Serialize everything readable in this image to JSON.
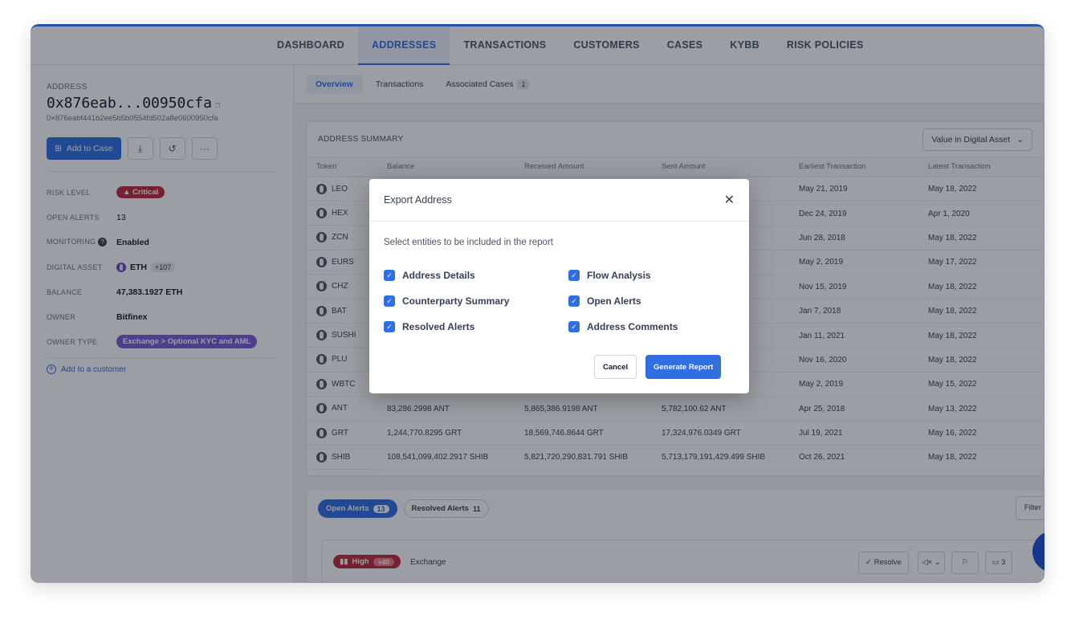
{
  "nav": {
    "tabs": [
      "DASHBOARD",
      "ADDRESSES",
      "TRANSACTIONS",
      "CUSTOMERS",
      "CASES",
      "KYBB",
      "RISK POLICIES"
    ],
    "active": "ADDRESSES"
  },
  "address": {
    "label": "ADDRESS",
    "short": "0x876eab...00950cfa",
    "full": "0×876eabf441b2ee5b5b0554fd502a8e0600950cfa",
    "add_to_case": "Add to Case"
  },
  "details": {
    "risk_level": {
      "k": "RISK LEVEL",
      "v": "Critical"
    },
    "open_alerts": {
      "k": "OPEN ALERTS",
      "v": "13"
    },
    "monitoring": {
      "k": "MONITORING",
      "v": "Enabled"
    },
    "digital_asset": {
      "k": "DIGITAL ASSET",
      "v": "ETH",
      "extra": "+107"
    },
    "balance": {
      "k": "BALANCE",
      "v": "47,383.1927 ETH"
    },
    "owner": {
      "k": "OWNER",
      "v": "Bitfinex"
    },
    "owner_type": {
      "k": "OWNER TYPE",
      "v": "Exchange > Optional KYC and AML"
    },
    "add_customer": "Add to a customer"
  },
  "subtabs": {
    "overview": "Overview",
    "transactions": "Transactions",
    "cases": "Associated Cases",
    "cases_count": "1"
  },
  "summary": {
    "title": "ADDRESS SUMMARY",
    "value_select": "Value in Digital Asset",
    "columns": [
      "Token",
      "Balance",
      "Received Amount",
      "Sent Amount",
      "Earliest Transaction",
      "Latest Transaction"
    ],
    "rows": [
      [
        "LEO",
        "",
        "",
        "",
        "May 21, 2019",
        "May 18, 2022"
      ],
      [
        "HEX",
        "",
        "",
        "",
        "Dec 24, 2019",
        "Apr 1, 2020"
      ],
      [
        "ZCN",
        "",
        "",
        "",
        "Jun 28, 2018",
        "May 18, 2022"
      ],
      [
        "EURS",
        "",
        "",
        "",
        "May 2, 2019",
        "May 17, 2022"
      ],
      [
        "CHZ",
        "",
        "",
        "",
        "Nov 15, 2019",
        "May 18, 2022"
      ],
      [
        "BAT",
        "",
        "",
        "",
        "Jan 7, 2018",
        "May 18, 2022"
      ],
      [
        "SUSHI",
        "",
        "",
        "",
        "Jan 11, 2021",
        "May 18, 2022"
      ],
      [
        "PLU",
        "",
        "",
        "",
        "Nov 16, 2020",
        "May 18, 2022"
      ],
      [
        "WBTC",
        "",
        "",
        "",
        "May 2, 2019",
        "May 15, 2022"
      ],
      [
        "ANT",
        "83,286.2998 ANT",
        "5,865,386.9198 ANT",
        "5,782,100.62 ANT",
        "Apr 25, 2018",
        "May 13, 2022"
      ],
      [
        "GRT",
        "1,244,770.8295 GRT",
        "18,569,746.8644 GRT",
        "17,324,976.0349 GRT",
        "Jul 19, 2021",
        "May 16, 2022"
      ],
      [
        "SHIB",
        "108,541,099,402.2917 SHIB",
        "5,821,720,290,831.791 SHIB",
        "5,713,179,191,429.499 SHIB",
        "Oct 26, 2021",
        "May 18, 2022"
      ]
    ]
  },
  "alerts": {
    "open_label": "Open Alerts",
    "open_count": "13",
    "resolved_label": "Resolved Alerts",
    "resolved_count": "11",
    "filter": "Filter",
    "card": {
      "severity": "High",
      "score": "+40",
      "category": "Exchange",
      "resolve": "Resolve",
      "comments": "3"
    }
  },
  "modal": {
    "title": "Export Address",
    "description": "Select entities to be included in the report",
    "options": [
      "Address Details",
      "Flow Analysis",
      "Counterparty Summary",
      "Open Alerts",
      "Resolved Alerts",
      "Address Comments"
    ],
    "cancel": "Cancel",
    "generate": "Generate Report"
  },
  "colors": {
    "primary": "#2f6fe0",
    "critical": "#c0263b",
    "owner_badge": "#7c5ad9"
  }
}
